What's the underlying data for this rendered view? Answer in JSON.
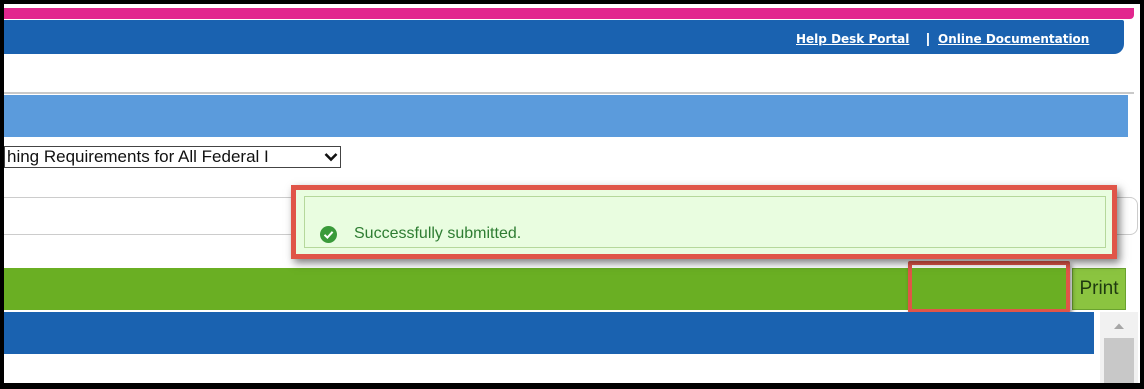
{
  "header": {
    "links": [
      "Help Desk Portal",
      "Online Documentation"
    ],
    "separator": "|"
  },
  "form": {
    "requirement_select": {
      "value": "hing Requirements for All Federal I"
    }
  },
  "toolbar": {
    "print_label": "Print"
  },
  "notification": {
    "status": "success",
    "message": "Successfully submitted."
  },
  "colors": {
    "pink_accent": "#e2268e",
    "header_blue": "#1a62b0",
    "section_blue": "#5b9bdc",
    "toolbar_green": "#6aaf23",
    "print_green": "#8bc440",
    "success_bg": "#e9fde0",
    "success_text": "#2e7d32",
    "highlight_red": "#e05548"
  }
}
